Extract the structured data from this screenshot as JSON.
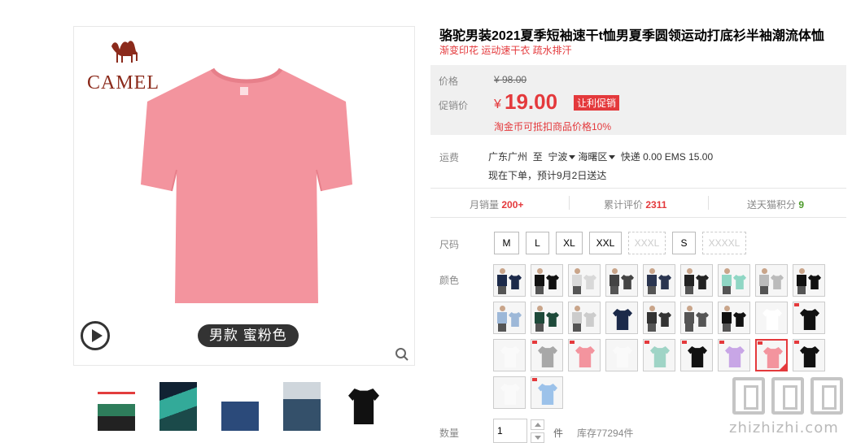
{
  "gallery": {
    "brand": "CAMEL",
    "variant_caption": "男款   蜜粉色",
    "shirt_color": "#f3949e",
    "thumbs": [
      "thumb-1",
      "thumb-2",
      "thumb-3",
      "thumb-4",
      "thumb-5"
    ]
  },
  "product": {
    "title": "骆驼男装2021夏季短袖速干t恤男夏季圆领运动打底衫半袖潮流体恤",
    "subtitle": "渐变印花 运动速干衣 疏水排汗"
  },
  "price": {
    "original_label": "价格",
    "original_value": "¥ 98.00",
    "promo_label": "促销价",
    "currency": "¥",
    "promo_value": "19.00",
    "promo_tag": "让利促销",
    "coin_note": "淘金币可抵扣商品价格10%"
  },
  "shipping": {
    "label": "运费",
    "from": "广东广州",
    "to_word": "至",
    "city": "宁波",
    "district": "海曙区",
    "fees": "快递 0.00 EMS 15.00",
    "eta": "现在下单，预计9月2日送达"
  },
  "stats": {
    "sales_label": "月销量",
    "sales_value": "200+",
    "reviews_label": "累计评价",
    "reviews_value": "2311",
    "points_label": "送天猫积分",
    "points_value": "9"
  },
  "size": {
    "label": "尺码",
    "options": [
      "M",
      "L",
      "XL",
      "XXL",
      "XXXL",
      "S",
      "XXXXL"
    ]
  },
  "color": {
    "label": "颜色"
  },
  "quantity": {
    "label": "数量",
    "value": "1",
    "unit": "件",
    "stock": "库存77294件"
  },
  "watermark": {
    "text": "zhizhizhi.com"
  },
  "colors": {
    "accent": "#e4393c",
    "price_bg": "#f0f0f0"
  }
}
